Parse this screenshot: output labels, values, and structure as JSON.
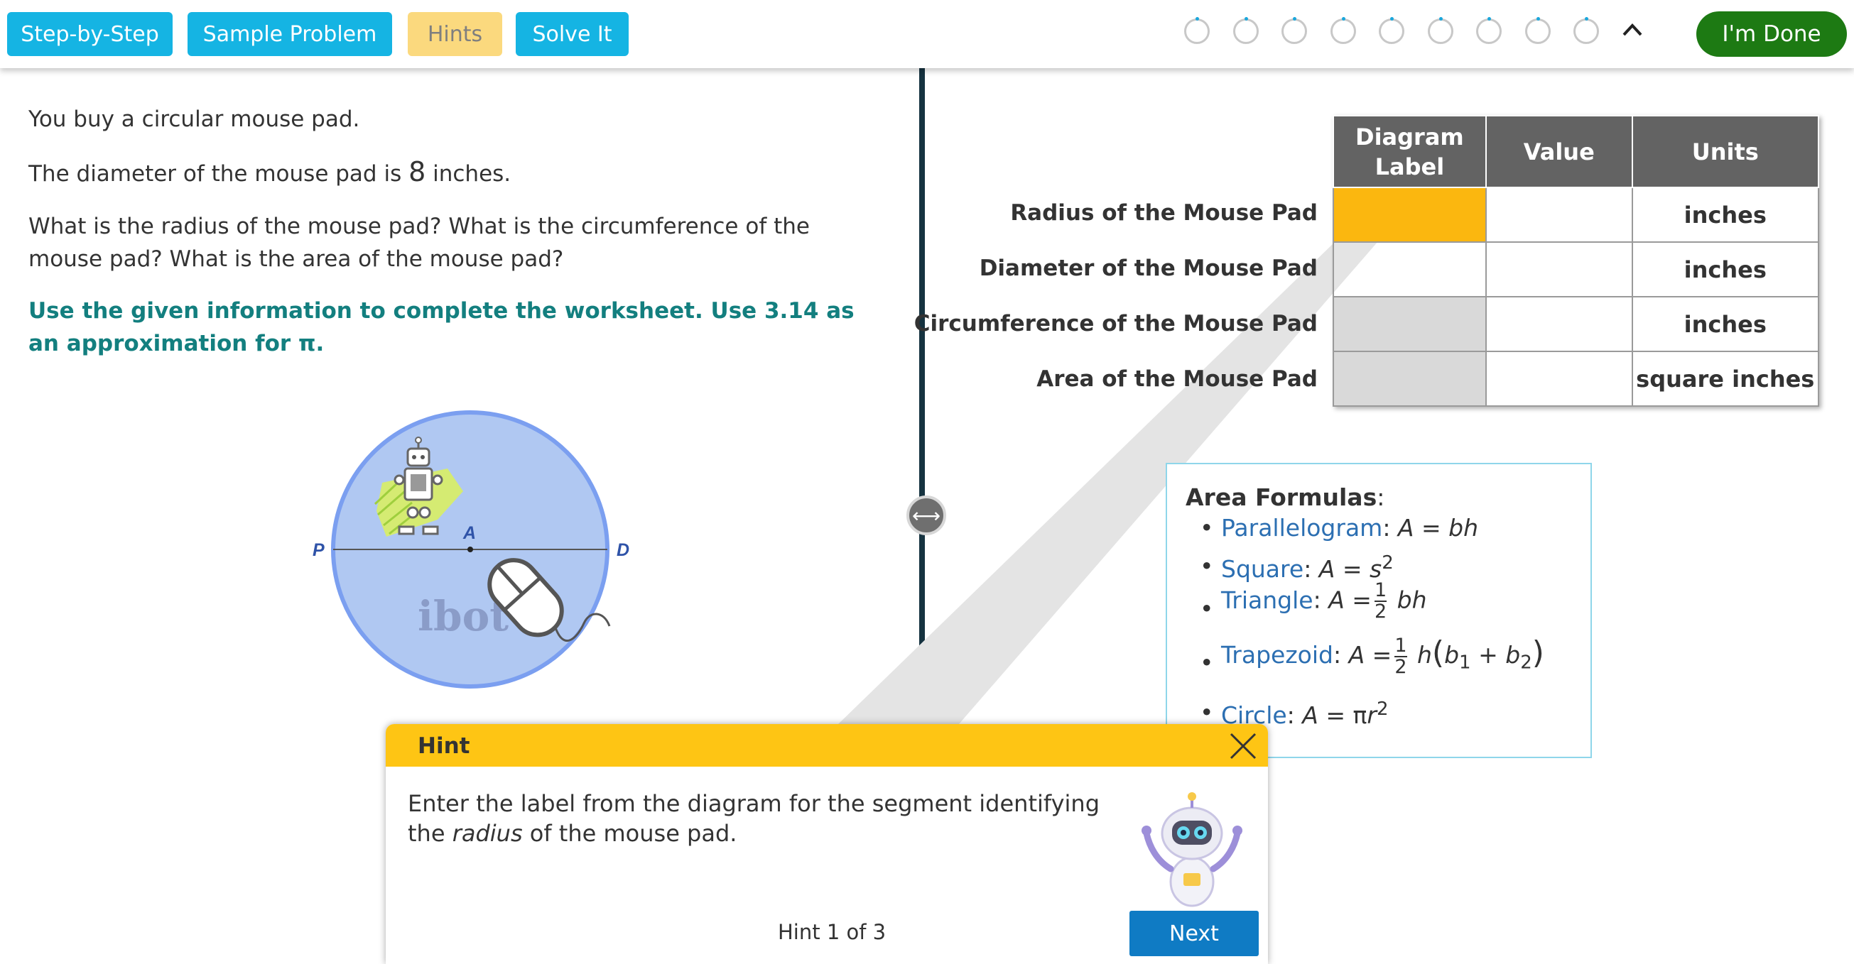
{
  "toolbar": {
    "step_by_step": "Step-by-Step",
    "sample_problem": "Sample Problem",
    "hints": "Hints",
    "solve_it": "Solve It",
    "done": "I'm Done",
    "progress_steps": 9
  },
  "problem": {
    "intro": "You buy a circular mouse pad.",
    "diameter_prefix": "The diameter of the mouse pad is",
    "diameter_value": "8",
    "diameter_suffix": "inches.",
    "question": "What is the radius of the mouse pad? What is the circumference of the mouse pad? What is the area of the mouse pad?",
    "instructions": "Use the given information to complete the worksheet. Use 3.14 as an approximation for π."
  },
  "diagram": {
    "point_p": "P",
    "point_a": "A",
    "point_d": "D",
    "brand": "ibot"
  },
  "worksheet": {
    "headers": {
      "label": "Diagram Label",
      "value": "Value",
      "units": "Units"
    },
    "rows": [
      {
        "name": "Radius of the Mouse Pad",
        "label": "",
        "value": "",
        "units": "inches"
      },
      {
        "name": "Diameter of the Mouse Pad",
        "label": "",
        "value": "",
        "units": "inches"
      },
      {
        "name": "Circumference of the Mouse Pad",
        "label": "",
        "value": "",
        "units": "inches"
      },
      {
        "name": "Area of the Mouse Pad",
        "label": "",
        "value": "",
        "units": "square inches"
      }
    ]
  },
  "formulas": {
    "title": "Area Formulas",
    "items": {
      "parallelogram": "Parallelogram",
      "square": "Square",
      "triangle": "Triangle",
      "trapezoid": "Trapezoid",
      "circle": "Circle"
    }
  },
  "hint": {
    "title": "Hint",
    "text_before": "Enter the label from the diagram for the segment identifying the ",
    "text_em": "radius",
    "text_after": " of the mouse pad.",
    "counter": "Hint 1 of 3",
    "next": "Next"
  },
  "colors": {
    "accent": "#15b4e3",
    "done": "#1d7a13",
    "hint_header": "#fec514",
    "active_cell": "#fbb70f",
    "instructions": "#137f7f",
    "link": "#2c6fb2"
  }
}
